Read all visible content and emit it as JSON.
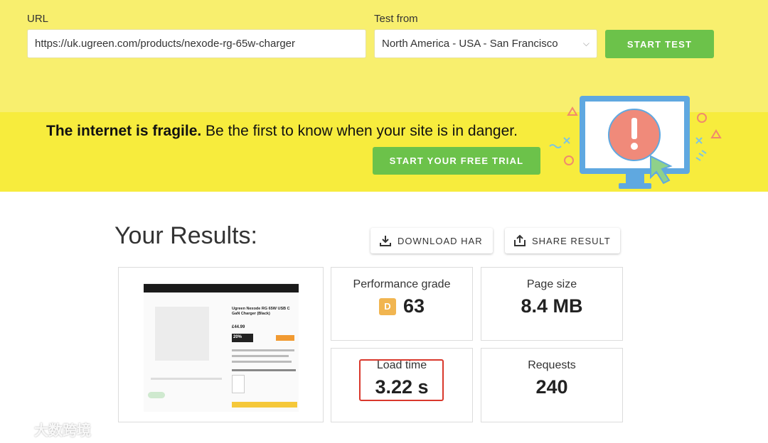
{
  "test_form": {
    "url_label": "URL",
    "url_value": "https://uk.ugreen.com/products/nexode-rg-65w-charger",
    "location_label": "Test from",
    "location_value": "North America - USA - San Francisco",
    "start_button": "START TEST"
  },
  "promo": {
    "headline_bold": "The internet is fragile.",
    "headline_rest": " Be the first to know when your site is in danger.",
    "cta": "START YOUR FREE TRIAL"
  },
  "results": {
    "title": "Your Results:",
    "download_button": "DOWNLOAD HAR",
    "share_button": "SHARE RESULT",
    "metrics": [
      {
        "label": "Performance grade",
        "grade": "D",
        "value": "63"
      },
      {
        "label": "Page size",
        "value": "8.4 MB"
      },
      {
        "label": "Load time",
        "value": "3.22 s"
      },
      {
        "label": "Requests",
        "value": "240"
      }
    ]
  },
  "thumbnail": {
    "product_title": "Ugreen Nexode RG 65W USB C GaN Charger (Black)",
    "price": "£44.99",
    "discount": "20%"
  },
  "icons": {
    "download": "download-icon",
    "share": "share-icon",
    "alert": "alert-monitor-icon",
    "chevron": "chevron-down-icon"
  },
  "colors": {
    "topbar": "#f8ef6e",
    "promo": "#f7ec3d",
    "accent_green": "#6cc24a",
    "grade_d": "#f1b550",
    "highlight": "#d9382c"
  },
  "watermark": "大数跨境"
}
